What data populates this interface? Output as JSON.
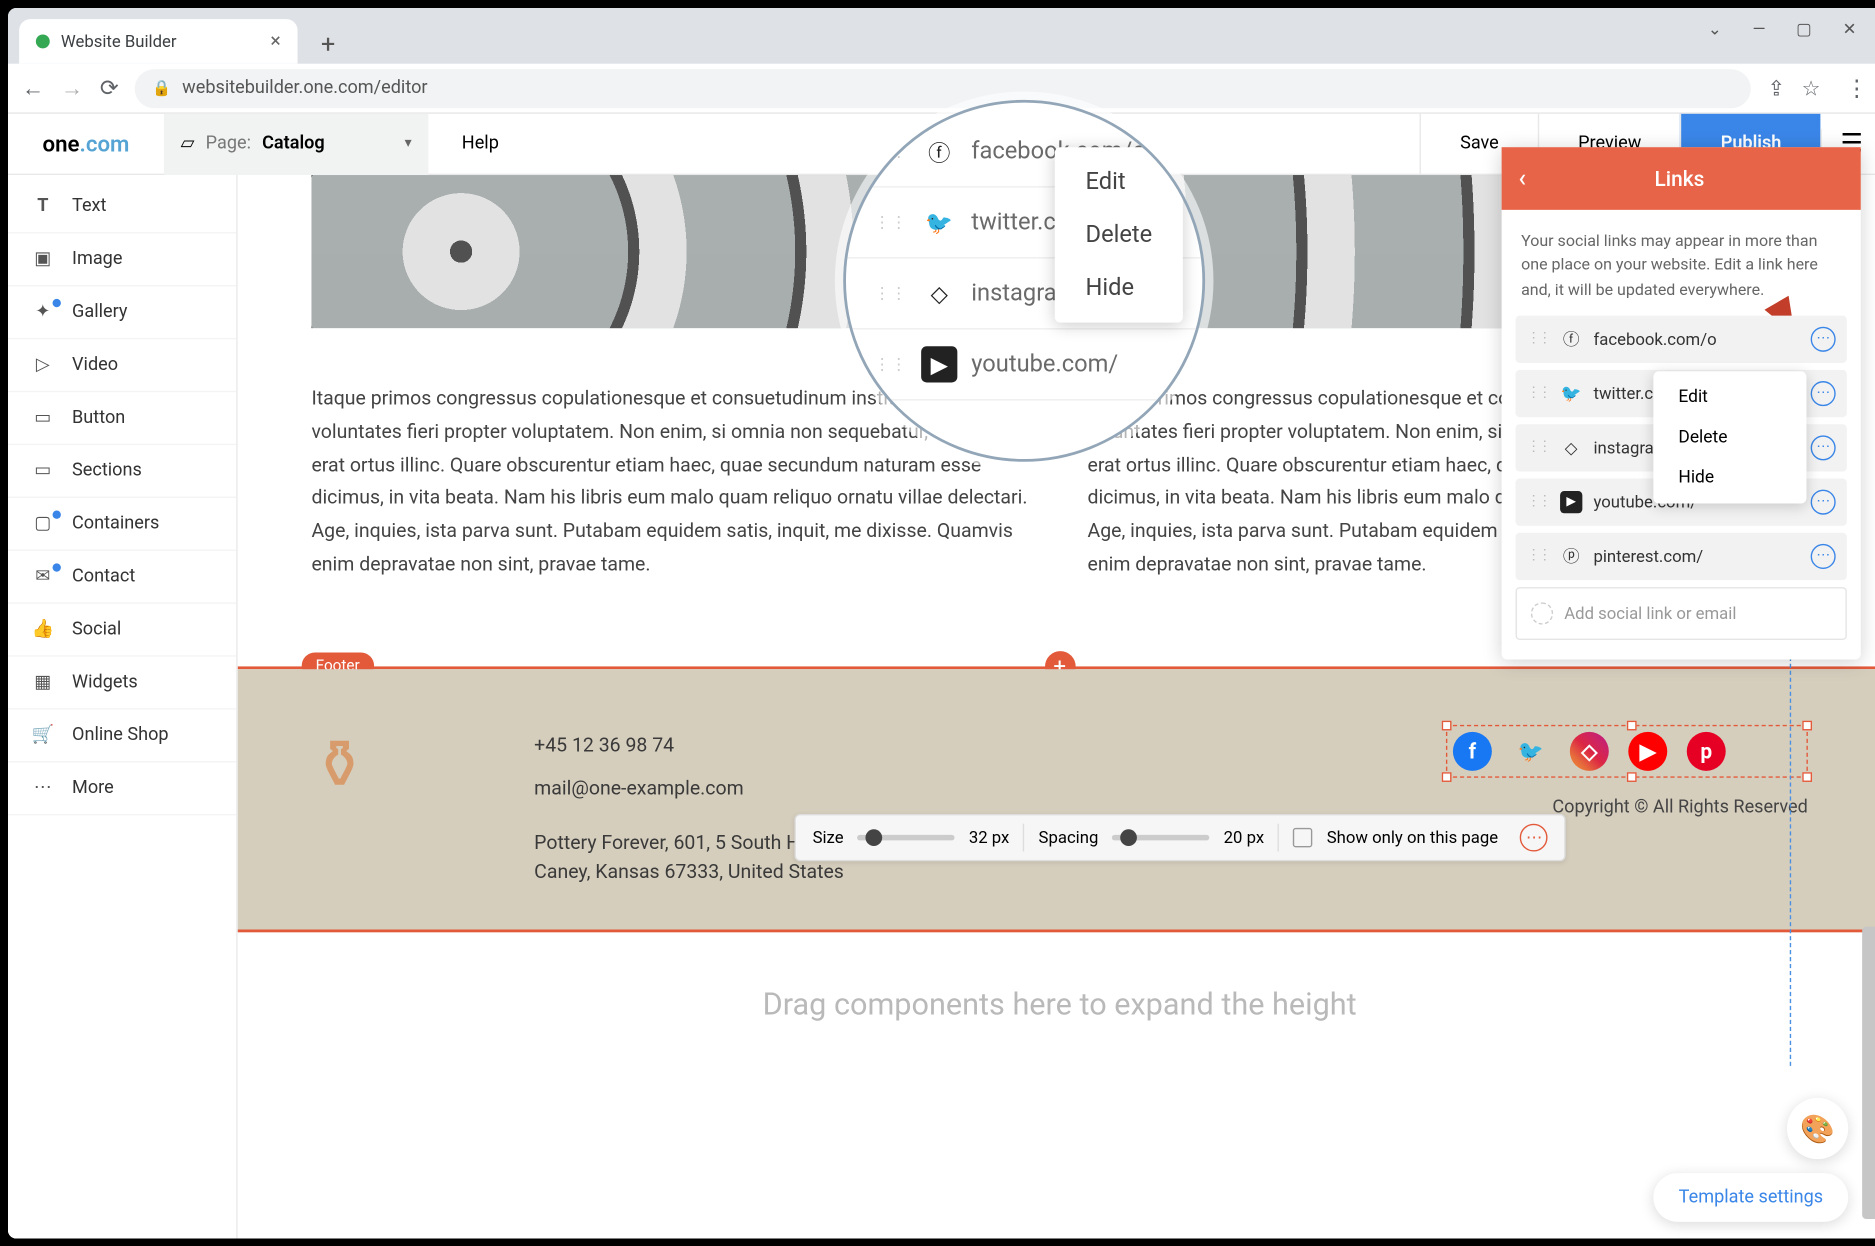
{
  "window": {
    "tab_title": "Website Builder"
  },
  "browser": {
    "url": "websitebuilder.one.com/editor"
  },
  "topbar": {
    "logo_a": "one",
    "logo_b": ".com",
    "page_label": "Page:",
    "page_value": "Catalog",
    "help": "Help",
    "save": "Save",
    "preview": "Preview",
    "publish": "Publish"
  },
  "sidebar": {
    "items": [
      {
        "icon": "T",
        "label": "Text",
        "bold": true
      },
      {
        "icon": "▣",
        "label": "Image"
      },
      {
        "icon": "✦",
        "label": "Gallery",
        "badge": true
      },
      {
        "icon": "▷",
        "label": "Video"
      },
      {
        "icon": "▭",
        "label": "Button"
      },
      {
        "icon": "▭",
        "label": "Sections"
      },
      {
        "icon": "▢",
        "label": "Containers",
        "badge": true
      },
      {
        "icon": "✉",
        "label": "Contact",
        "badge": true
      },
      {
        "icon": "👍",
        "label": "Social"
      },
      {
        "icon": "▦",
        "label": "Widgets"
      },
      {
        "icon": "🛒",
        "label": "Online Shop"
      },
      {
        "icon": "⋯",
        "label": "More"
      }
    ]
  },
  "body_text_left": "Itaque primos congressus copulationesque et consuetudinum instituendarum voluntates fieri propter voluptatem. Non enim, si omnia non sequebatur, idcirco non erat ortus illinc. Quare obscurentur etiam haec, quae secundum naturam esse dicimus, in vita beata. Nam his libris eum malo quam reliquo ornatu villae delectari. Age, inquies, ista parva sunt. Putabam equidem satis, inquit, me dixisse. Quamvis enim depravatae non sint, pravae tame.",
  "body_text_right": "Itaque primos congressus copulationesque et consuetudinum instituendarum voluntates fieri propter voluptatem. Non enim, si omnia non sequebatur, idcirco non erat ortus illinc. Quare obscurentur etiam haec, quae secundum naturam esse dicimus, in vita beata. Nam his libris eum malo quam reliquo ornatu villae delectari. Age, inquies, ista parva sunt. Putabam equidem satis, inquit, me dixisse. Quamvis enim depravatae non sint, pravae tame.",
  "footer": {
    "tag": "Footer",
    "phone": "+45 12 36 98 74",
    "email": "mail@one-example.com",
    "address": "Pottery Forever, 601, 5 South High Street, Caney, Kansas 67333, United States",
    "copyright": "Copyright © All Rights Reserved"
  },
  "settings_bar": {
    "size_label": "Size",
    "size_value": "32 px",
    "spacing_label": "Spacing",
    "spacing_value": "20 px",
    "checkbox_label": "Show only on this page"
  },
  "links_panel": {
    "title": "Links",
    "desc": "Your social links may appear in more than one place on your website. Edit a link here and, it will be updated everywhere.",
    "rows": [
      {
        "icon": "f",
        "text": "facebook.com/o"
      },
      {
        "icon": "t",
        "text": "twitter.com/"
      },
      {
        "icon": "i",
        "text": "instagram.com/"
      },
      {
        "icon": "▶",
        "text": "youtube.com/"
      },
      {
        "icon": "p",
        "text": "pinterest.com/"
      }
    ],
    "add_placeholder": "Add social link or email"
  },
  "context_menu": {
    "edit": "Edit",
    "delete": "Delete",
    "hide": "Hide"
  },
  "zoom_rows": [
    {
      "icon": "f",
      "text": "facebook.com/o"
    },
    {
      "icon": "t",
      "text": "twitter.com/"
    },
    {
      "icon": "i",
      "text": "instagram.com/"
    },
    {
      "icon": "▶",
      "text": "youtube.com/"
    }
  ],
  "dropzone": "Drag components here to expand the height",
  "fab": {
    "template": "Template settings"
  }
}
